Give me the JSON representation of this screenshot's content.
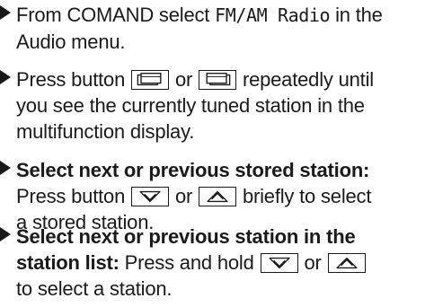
{
  "items": [
    {
      "pre": "From COMAND select ",
      "code": "FM/AM Radio",
      "post_line1": " in the",
      "line2": "Audio menu."
    },
    {
      "line1_pre": "Press button ",
      "key1_icon": "previous-page-key-icon",
      "line1_mid": " or ",
      "key2_icon": "next-page-key-icon",
      "line1_post": " repeatedly until",
      "line2": "you see the currently tuned station in the",
      "line3": "multifunction display."
    },
    {
      "bold": "Select next or previous stored station:",
      "line2_pre": "Press button ",
      "key1_icon": "down-arrow-key-icon",
      "line2_mid": " or ",
      "key2_icon": "up-arrow-key-icon",
      "line2_post": " briefly to select",
      "line3": "a stored station."
    },
    {
      "bold_line1": "Select next or previous station in the",
      "bold_line2": "station list:",
      "line2_post": " Press and hold ",
      "key1_icon": "down-arrow-key-icon",
      "line2_mid": " or ",
      "key2_icon": "up-arrow-key-icon",
      "line3": "to select a station."
    }
  ]
}
